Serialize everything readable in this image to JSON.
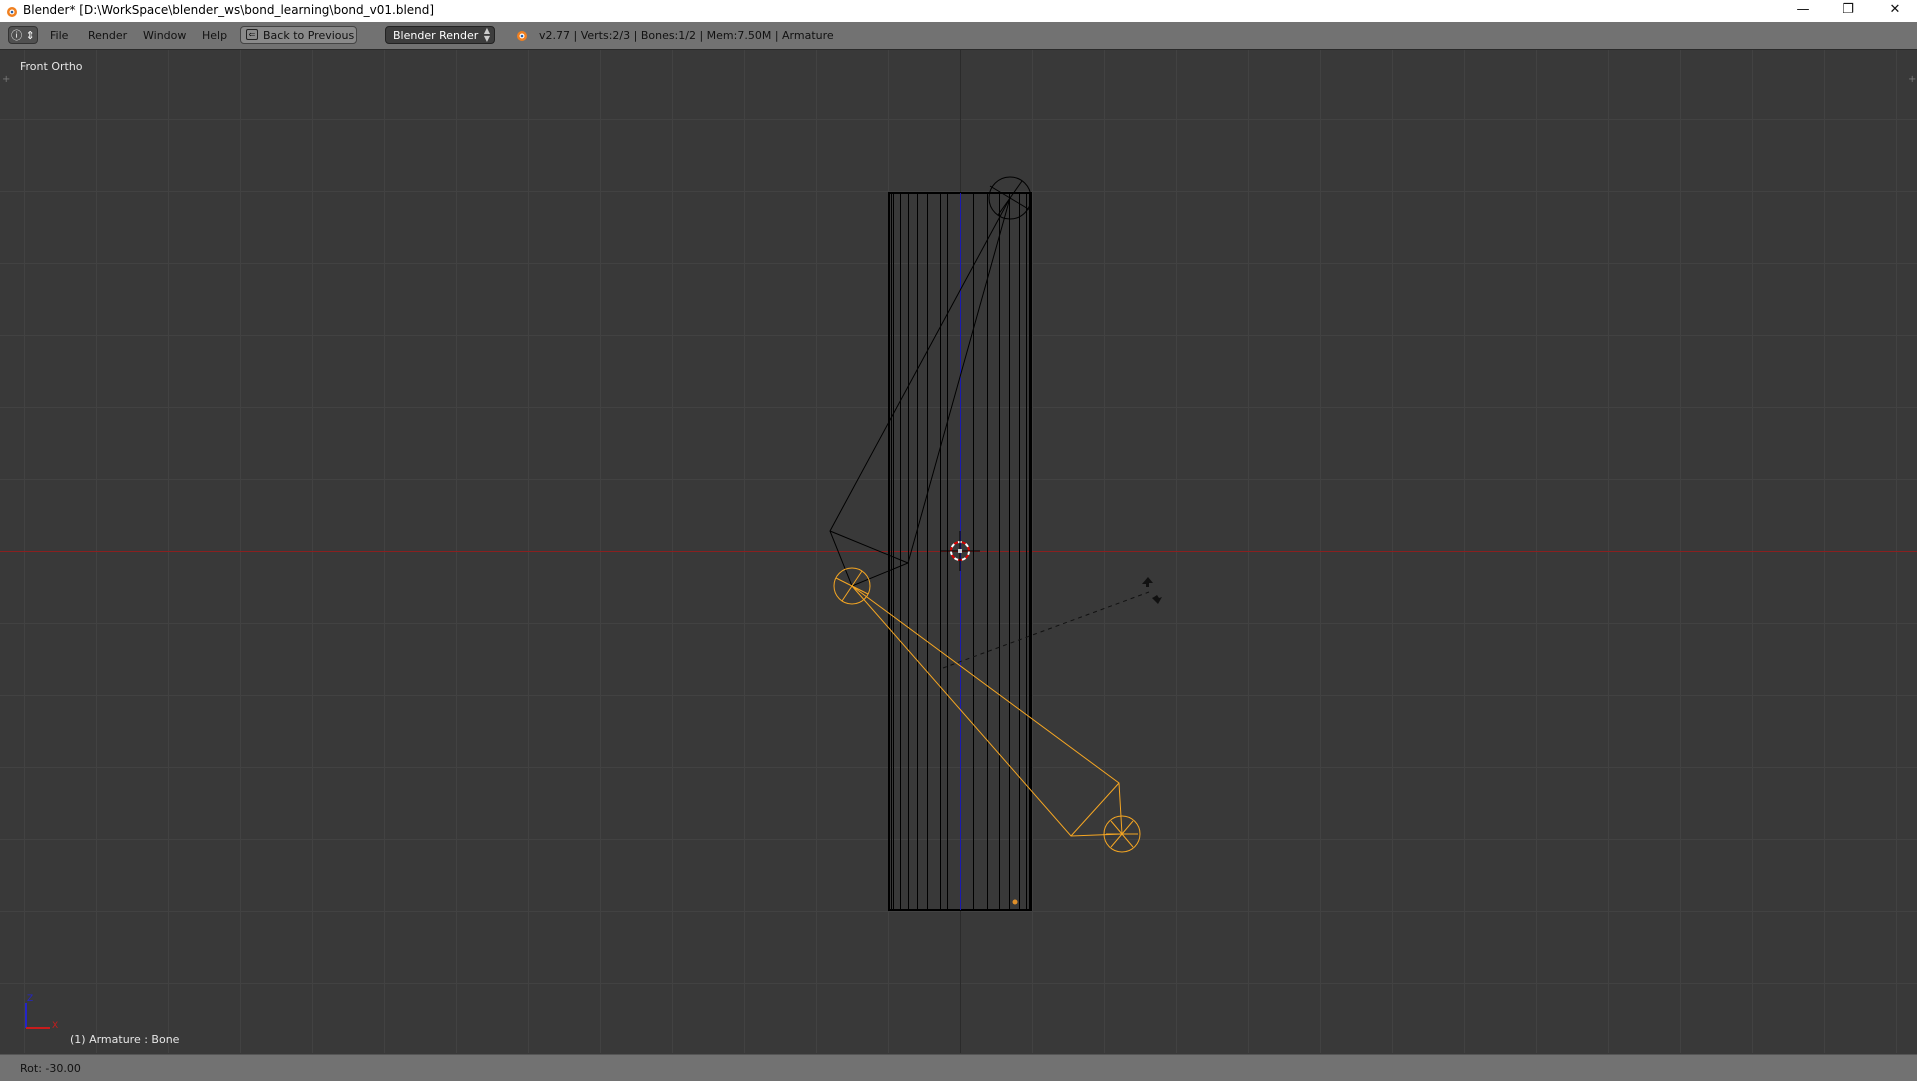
{
  "window": {
    "title": "Blender* [D:\\WorkSpace\\blender_ws\\bond_learning\\bond_v01.blend]",
    "controls": {
      "minimize": "—",
      "restore": "❐",
      "close": "✕"
    }
  },
  "header": {
    "editor_icon": "info-icon",
    "menus": [
      "File",
      "Render",
      "Window",
      "Help"
    ],
    "back_button": "Back to Previous",
    "render_engine": "Blender Render",
    "info": "v2.77 | Verts:2/3 | Bones:1/2 | Mem:7.50M | Armature"
  },
  "viewport": {
    "view_label": "Front Ortho",
    "object_label": "(1) Armature : Bone",
    "axis_labels": {
      "z": "Z",
      "x": "X"
    },
    "colors": {
      "selected_bone": "#f5a623",
      "x_axis": "#b01c1c",
      "z_axis": "#2424c8",
      "background": "#393939"
    }
  },
  "status": {
    "text": "Rot: -30.00"
  }
}
